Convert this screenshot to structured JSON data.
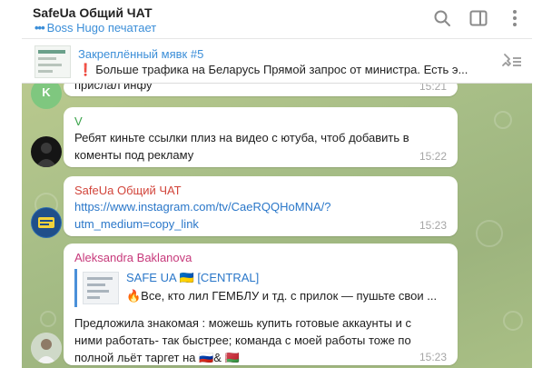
{
  "header": {
    "title": "SafeUa Общий ЧАТ",
    "typing": "Boss Hugo печатает",
    "icons": [
      "search-icon",
      "sidebar-toggle-icon",
      "more-vertical-icon"
    ]
  },
  "pinned": {
    "title": "Закреплённый мявк #5",
    "text": "Больше трафика на Беларусь  Прямой запрос от министра. Есть э...",
    "excl": "❗"
  },
  "messages": [
    {
      "sender": "",
      "text": "прислал инфу",
      "time": "15:21",
      "avatar_letter": "K",
      "avatar_color": "#7fc77f"
    },
    {
      "sender": "V",
      "sender_color": "#3aa34a",
      "lines": [
        "Ребят киньте ссылки плиз на видео с ютуба, чтоб добавить в",
        "коменты под рекламу"
      ],
      "time": "15:22"
    },
    {
      "sender": "SafeUa Общий ЧАТ",
      "sender_color": "#d2453b",
      "lines": [
        "https://www.instagram.com/tv/CaeRQQHoMNA/?",
        "utm_medium=copy_link"
      ],
      "time": "15:23"
    },
    {
      "sender": "Aleksandra Baklanova",
      "sender_color": "#c7397b",
      "forward": {
        "title": "SAFE UA 🇺🇦 [CENTRAL]",
        "text": "🔥Все, кто лил ГЕМБЛУ и тд. с прилок — пушьте свои ..."
      },
      "lines": [
        "Предложила знакомая : можешь купить готовые аккаунты и с",
        "ними работать- так быстрее; команда с моей работы тоже по",
        "полной льёт таргет на 🇷🇺& 🇧🇾"
      ],
      "time": "15:23"
    }
  ]
}
